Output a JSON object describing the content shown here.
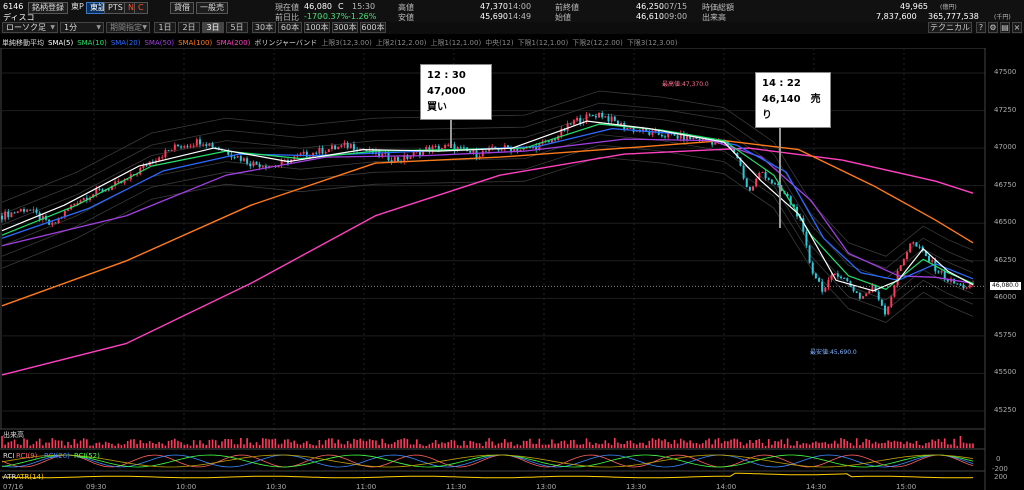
{
  "header": {
    "code": "6146",
    "name": "ディスコ",
    "buttons": [
      "銘柄登録",
      "東P",
      "東証",
      "PTS",
      "N",
      "C",
      "貸借",
      "一般売"
    ],
    "current_price_label": "現在値",
    "current_price": "46,080",
    "current_price_flag": "C",
    "current_time": "15:30",
    "change_label": "前日比",
    "change": "-170",
    "change_pct": "-0.37%",
    "change_pct2": "-1.26%",
    "high_label": "高値",
    "high": "47,370",
    "high_time": "14:00",
    "low_label": "安値",
    "low": "45,690",
    "low_time": "14:49",
    "prev_close_label": "前終値",
    "prev_close": "46,250",
    "prev_close_date": "07/15",
    "open_label": "始値",
    "open": "46,610",
    "open_time": "09:00",
    "market_cap_label": "時価総額",
    "market_cap": "49,965",
    "market_cap_unit": "(億円)",
    "volume_label": "出来高",
    "volume": "7,837,600",
    "turnover": "365,777,538",
    "turnover_unit": "(千円)"
  },
  "toolbar": {
    "chart_type": "ローソク足",
    "interval": "1分",
    "period_select": "期間指定",
    "ranges": [
      "1日",
      "2日",
      "3日",
      "5日",
      "30本",
      "60本",
      "100本",
      "300本",
      "600本"
    ],
    "technical": "テクニカル"
  },
  "legend": {
    "items": [
      {
        "text": "単純移動平均",
        "color": "#dddddd"
      },
      {
        "text": "SMA(5)",
        "color": "#ffffff"
      },
      {
        "text": "SMA(10)",
        "color": "#22e06a"
      },
      {
        "text": "SMA(20)",
        "color": "#2a6bff"
      },
      {
        "text": "SMA(50)",
        "color": "#a040e0"
      },
      {
        "text": "SMA(100)",
        "color": "#ff7a1a"
      },
      {
        "text": "SMA(200)",
        "color": "#ff40c0"
      },
      {
        "text": "ボリンジャーバンド",
        "color": "#dddddd"
      },
      {
        "text": "上限3(12,3.00)",
        "color": "#888888"
      },
      {
        "text": "上限2(12,2.00)",
        "color": "#888888"
      },
      {
        "text": "上限1(12,1.00)",
        "color": "#888888"
      },
      {
        "text": "中央(12)",
        "color": "#888888"
      },
      {
        "text": "下限1(12,1.00)",
        "color": "#888888"
      },
      {
        "text": "下限2(12,2.00)",
        "color": "#888888"
      },
      {
        "text": "下限3(12,3.00)",
        "color": "#888888"
      }
    ]
  },
  "annotations": {
    "buy": {
      "time": "12 : 30",
      "text": "47,000　買い"
    },
    "sell": {
      "time": "14 : 22",
      "text": "46,140　売り"
    },
    "high_tag": "最高値:47,370.0",
    "low_tag": "最安値:45,690.0",
    "last_price_tag": "46,080.0"
  },
  "sub_panels": {
    "volume_label": "出来高",
    "rci_label": "RCI",
    "rci_items": [
      "RCI(9)",
      "RCI(26)",
      "RCI(52)"
    ],
    "rci_ticks": [
      "0",
      "-200"
    ],
    "atr_label": "ATR",
    "atr_item": "ATR(14)",
    "atr_ticks": [
      "200"
    ]
  },
  "chart_data": {
    "type": "candlestick",
    "x_labels": [
      "07/16",
      "09:30",
      "10:00",
      "10:30",
      "11:00",
      "11:30",
      "13:00",
      "13:30",
      "14:00",
      "14:30",
      "15:00"
    ],
    "y_ticks": [
      45250,
      45500,
      45750,
      46000,
      46250,
      46500,
      46750,
      47000,
      47250,
      47500
    ],
    "ylim": [
      45150,
      47600
    ],
    "close_path": [
      [
        0,
        46550
      ],
      [
        4,
        46600
      ],
      [
        8,
        46480
      ],
      [
        12,
        46650
      ],
      [
        16,
        46720
      ],
      [
        20,
        46780
      ],
      [
        24,
        46920
      ],
      [
        28,
        47010
      ],
      [
        32,
        47050
      ],
      [
        36,
        46980
      ],
      [
        40,
        46900
      ],
      [
        44,
        46880
      ],
      [
        48,
        46950
      ],
      [
        52,
        46990
      ],
      [
        56,
        47020
      ],
      [
        60,
        46960
      ],
      [
        64,
        46920
      ],
      [
        68,
        46990
      ],
      [
        72,
        47010
      ],
      [
        76,
        46960
      ],
      [
        80,
        47000
      ],
      [
        84,
        46990
      ],
      [
        88,
        47040
      ],
      [
        92,
        47180
      ],
      [
        96,
        47230
      ],
      [
        100,
        47140
      ],
      [
        104,
        47100
      ],
      [
        108,
        47080
      ],
      [
        112,
        47060
      ],
      [
        116,
        47030
      ],
      [
        118,
        46960
      ],
      [
        120,
        46700
      ],
      [
        122,
        46850
      ],
      [
        124,
        46760
      ],
      [
        126,
        46680
      ],
      [
        128,
        46550
      ],
      [
        130,
        46200
      ],
      [
        132,
        46050
      ],
      [
        134,
        46180
      ],
      [
        136,
        46100
      ],
      [
        138,
        46000
      ],
      [
        140,
        46080
      ],
      [
        142,
        45900
      ],
      [
        144,
        46180
      ],
      [
        146,
        46380
      ],
      [
        148,
        46300
      ],
      [
        150,
        46200
      ],
      [
        152,
        46120
      ],
      [
        154,
        46080
      ],
      [
        156,
        46080
      ]
    ],
    "sma5": [
      [
        0,
        46450
      ],
      [
        10,
        46620
      ],
      [
        22,
        46880
      ],
      [
        34,
        47000
      ],
      [
        46,
        46910
      ],
      [
        58,
        46990
      ],
      [
        70,
        46980
      ],
      [
        82,
        47000
      ],
      [
        94,
        47180
      ],
      [
        104,
        47130
      ],
      [
        116,
        47040
      ],
      [
        122,
        46780
      ],
      [
        128,
        46560
      ],
      [
        134,
        46120
      ],
      [
        140,
        46050
      ],
      [
        144,
        46120
      ],
      [
        148,
        46330
      ],
      [
        152,
        46180
      ],
      [
        156,
        46090
      ]
    ],
    "sma10": [
      [
        0,
        46420
      ],
      [
        12,
        46620
      ],
      [
        24,
        46880
      ],
      [
        36,
        46980
      ],
      [
        48,
        46930
      ],
      [
        60,
        46980
      ],
      [
        72,
        46990
      ],
      [
        84,
        47000
      ],
      [
        96,
        47160
      ],
      [
        106,
        47120
      ],
      [
        116,
        47050
      ],
      [
        124,
        46820
      ],
      [
        130,
        46420
      ],
      [
        136,
        46150
      ],
      [
        142,
        46060
      ],
      [
        148,
        46260
      ],
      [
        152,
        46170
      ],
      [
        156,
        46100
      ]
    ],
    "sma20": [
      [
        0,
        46400
      ],
      [
        14,
        46600
      ],
      [
        26,
        46850
      ],
      [
        38,
        46960
      ],
      [
        50,
        46950
      ],
      [
        62,
        46970
      ],
      [
        74,
        46990
      ],
      [
        86,
        47010
      ],
      [
        98,
        47130
      ],
      [
        110,
        47090
      ],
      [
        118,
        47020
      ],
      [
        126,
        46840
      ],
      [
        132,
        46400
      ],
      [
        138,
        46170
      ],
      [
        144,
        46120
      ],
      [
        150,
        46230
      ],
      [
        156,
        46130
      ]
    ],
    "sma50": [
      [
        0,
        46350
      ],
      [
        20,
        46550
      ],
      [
        36,
        46820
      ],
      [
        52,
        46940
      ],
      [
        68,
        46950
      ],
      [
        84,
        46980
      ],
      [
        100,
        47060
      ],
      [
        114,
        47050
      ],
      [
        122,
        46940
      ],
      [
        130,
        46650
      ],
      [
        136,
        46300
      ],
      [
        144,
        46150
      ],
      [
        150,
        46140
      ],
      [
        156,
        46100
      ]
    ],
    "sma100": [
      [
        0,
        45950
      ],
      [
        20,
        46250
      ],
      [
        40,
        46620
      ],
      [
        60,
        46900
      ],
      [
        80,
        46940
      ],
      [
        100,
        47000
      ],
      [
        116,
        47050
      ],
      [
        128,
        46990
      ],
      [
        140,
        46750
      ],
      [
        150,
        46520
      ],
      [
        156,
        46370
      ]
    ],
    "sma200": [
      [
        0,
        45490
      ],
      [
        20,
        45700
      ],
      [
        40,
        46100
      ],
      [
        60,
        46550
      ],
      [
        80,
        46820
      ],
      [
        100,
        46960
      ],
      [
        120,
        47000
      ],
      [
        135,
        46920
      ],
      [
        150,
        46780
      ],
      [
        156,
        46700
      ]
    ]
  }
}
